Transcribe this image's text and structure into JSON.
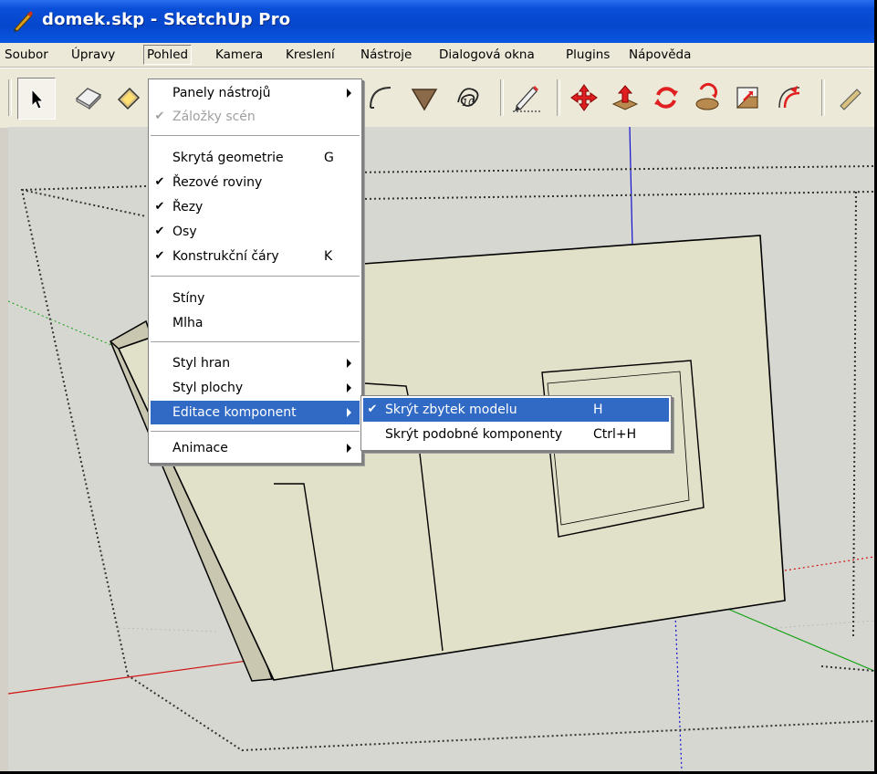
{
  "window": {
    "title": "domek.skp - SketchUp Pro"
  },
  "menubar": {
    "items": [
      "Soubor",
      "Úpravy",
      "Pohled",
      "Kamera",
      "Kreslení",
      "Nástroje",
      "Dialogová okna",
      "Plugins",
      "Nápověda"
    ],
    "active": "Pohled"
  },
  "toolbar": {
    "icons": [
      "select-icon",
      "eraser-icon",
      "paint-bucket-icon",
      "arc-icon",
      "triangle-icon",
      "freehand-icon",
      "pencil-icon",
      "move-icon",
      "push-pull-icon",
      "rotate-icon",
      "follow-me-icon",
      "scale-icon",
      "offset-icon",
      "tape-measure-icon"
    ]
  },
  "view_menu": {
    "items": [
      {
        "label": "Panely nástrojů",
        "submenu": true
      },
      {
        "label": "Záložky scén",
        "checked": true,
        "disabled": true
      },
      {
        "separator": true
      },
      {
        "label": "Skrytá geometrie",
        "shortcut": "G"
      },
      {
        "label": "Řezové roviny",
        "checked": true
      },
      {
        "label": "Řezy",
        "checked": true
      },
      {
        "label": "Osy",
        "checked": true
      },
      {
        "label": "Konstrukční čáry",
        "checked": true,
        "shortcut": "K"
      },
      {
        "separator": true
      },
      {
        "label": "Stíny"
      },
      {
        "label": "Mlha"
      },
      {
        "separator": true
      },
      {
        "label": "Styl hran",
        "submenu": true
      },
      {
        "label": "Styl plochy",
        "submenu": true
      },
      {
        "label": "Editace komponent",
        "submenu": true,
        "highlighted": true
      },
      {
        "separator": true
      },
      {
        "label": "Animace",
        "submenu": true
      }
    ]
  },
  "component_submenu": {
    "items": [
      {
        "label": "Skrýt zbytek modelu",
        "shortcut": "H",
        "checked": true,
        "highlighted": true
      },
      {
        "label": "Skrýt podobné komponenty",
        "shortcut": "Ctrl+H"
      }
    ]
  },
  "colors": {
    "title_bar": "#0a4fd8",
    "menu_bar": "#ece9d8",
    "highlight": "#316ac5",
    "viewport": "#d7d7d2",
    "face": "#e1e0c8",
    "axis_red": "#d01010",
    "axis_green": "#10a010",
    "axis_blue": "#1010d0"
  }
}
